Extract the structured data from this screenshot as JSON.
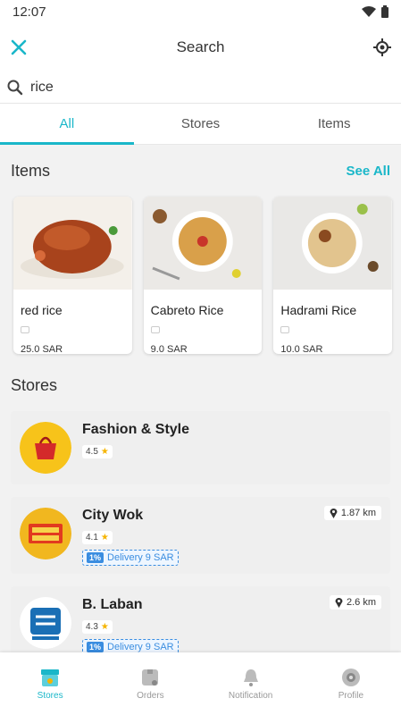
{
  "status": {
    "time": "12:07"
  },
  "appbar": {
    "title": "Search"
  },
  "search": {
    "value": "rice",
    "placeholder": ""
  },
  "tabs": [
    {
      "label": "All",
      "active": true
    },
    {
      "label": "Stores",
      "active": false
    },
    {
      "label": "Items",
      "active": false
    }
  ],
  "items_section": {
    "title": "Items",
    "see_all": "See All"
  },
  "items": [
    {
      "name": "red rice",
      "price": "25.0 SAR"
    },
    {
      "name": "Cabreto Rice",
      "price": "9.0 SAR"
    },
    {
      "name": "Hadrami Rice",
      "price": "10.0 SAR"
    }
  ],
  "stores_section": {
    "title": "Stores"
  },
  "stores": [
    {
      "name": "Fashion & Style",
      "rating": "4.5",
      "distance": "",
      "delivery": ""
    },
    {
      "name": "City Wok",
      "rating": "4.1",
      "distance": "1.87 km",
      "delivery": "Delivery 9 SAR"
    },
    {
      "name": "B. Laban",
      "rating": "4.3",
      "distance": "2.6 km",
      "delivery": "Delivery 9 SAR"
    }
  ],
  "bottom_nav": [
    {
      "label": "Stores",
      "icon": "store-icon",
      "active": true
    },
    {
      "label": "Orders",
      "icon": "orders-icon",
      "active": false
    },
    {
      "label": "Notification",
      "icon": "bell-icon",
      "active": false
    },
    {
      "label": "Profile",
      "icon": "profile-icon",
      "active": false
    }
  ],
  "colors": {
    "accent": "#1ab7c9",
    "delivery": "#3a8de0",
    "star": "#f5b400"
  }
}
